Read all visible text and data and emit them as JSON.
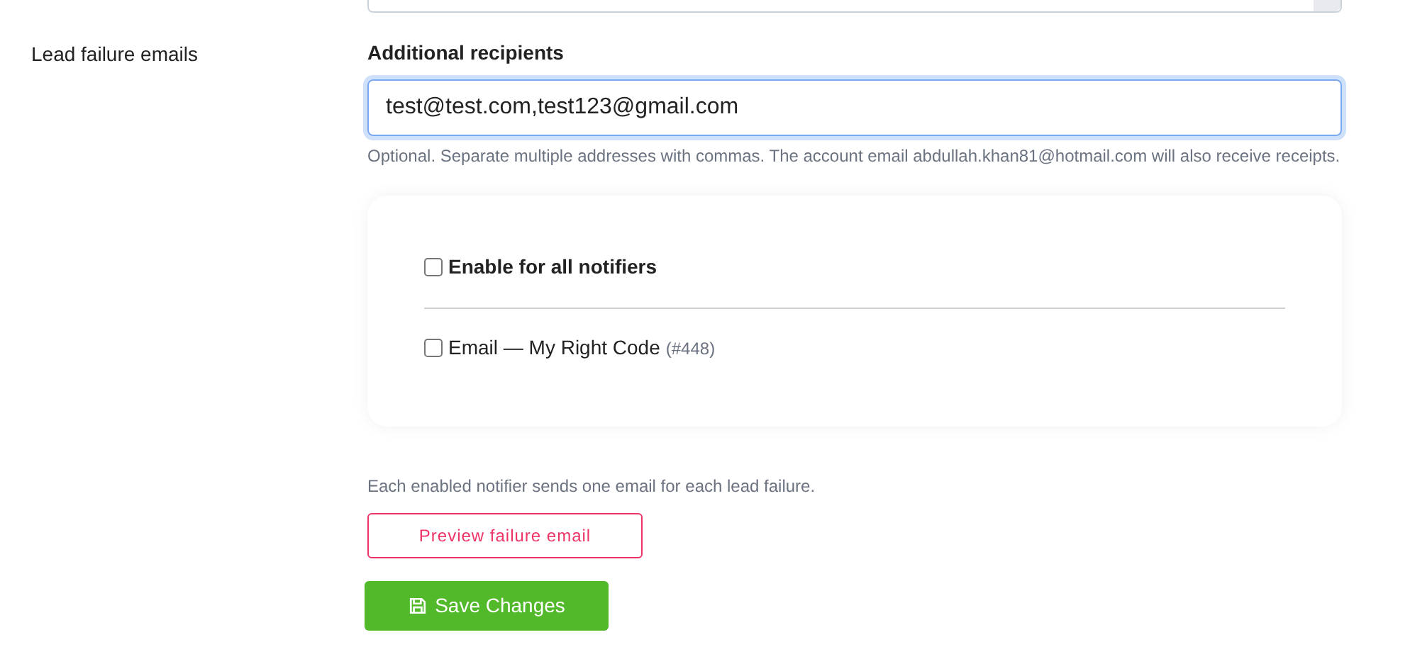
{
  "section_label": "Lead failure emails",
  "recipients": {
    "label": "Additional recipients",
    "value": "test@test.com,test123@gmail.com",
    "help": "Optional. Separate multiple addresses with commas. The account email abdullah.khan81@hotmail.com will also receive receipts."
  },
  "notifiers": [
    {
      "kind": "all",
      "label": "Enable for all notifiers",
      "checked": false
    },
    {
      "kind": "item",
      "label": "Email — My Right Code",
      "id": "(#448)",
      "checked": false
    }
  ],
  "note": "Each enabled notifier sends one email for each lead failure.",
  "buttons": [
    {
      "kind": "outline",
      "label": "Preview failure email"
    },
    {
      "kind": "primary",
      "label": "Save Changes"
    }
  ]
}
